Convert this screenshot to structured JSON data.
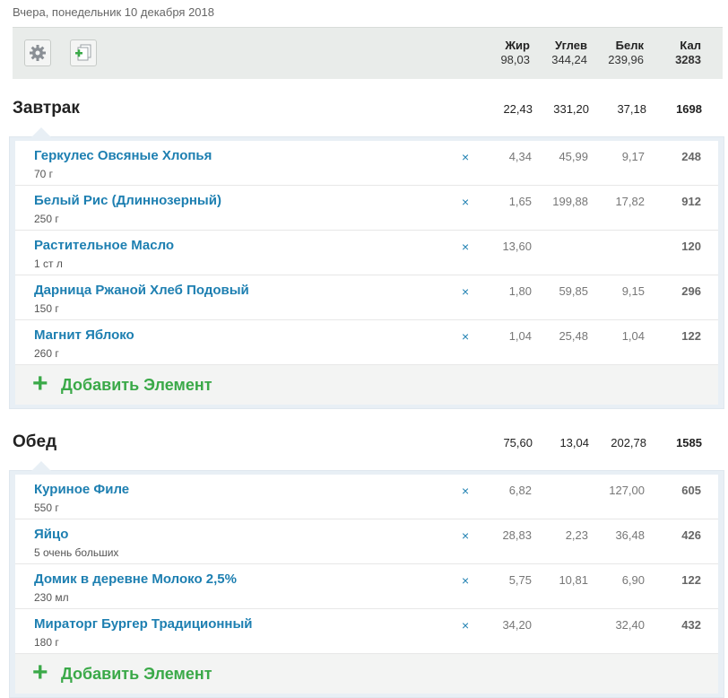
{
  "date_label": "Вчера, понедельник 10 декабря 2018",
  "toolbar": {
    "settings_icon": "gear-icon",
    "copy_icon": "copy-add-icon"
  },
  "totals": {
    "fat_label": "Жир",
    "fat": "98,03",
    "carbs_label": "Углев",
    "carbs": "344,24",
    "protein_label": "Белк",
    "protein": "239,96",
    "cal_label": "Кал",
    "cal": "3283"
  },
  "meals": [
    {
      "title": "Завтрак",
      "fat": "22,43",
      "carbs": "331,20",
      "protein": "37,18",
      "cal": "1698",
      "items": [
        {
          "name": "Геркулес Овсяные Хлопья",
          "qty": "70 г",
          "fat": "4,34",
          "carbs": "45,99",
          "protein": "9,17",
          "cal": "248"
        },
        {
          "name": "Белый Рис (Длиннозерный)",
          "qty": "250 г",
          "fat": "1,65",
          "carbs": "199,88",
          "protein": "17,82",
          "cal": "912"
        },
        {
          "name": "Растительное Масло",
          "qty": "1 ст л",
          "fat": "13,60",
          "carbs": "",
          "protein": "",
          "cal": "120"
        },
        {
          "name": "Дарница Ржаной Хлеб Подовый",
          "qty": "150 г",
          "fat": "1,80",
          "carbs": "59,85",
          "protein": "9,15",
          "cal": "296"
        },
        {
          "name": "Магнит Яблоко",
          "qty": "260 г",
          "fat": "1,04",
          "carbs": "25,48",
          "protein": "1,04",
          "cal": "122"
        }
      ],
      "add_label": "Добавить Элемент"
    },
    {
      "title": "Обед",
      "fat": "75,60",
      "carbs": "13,04",
      "protein": "202,78",
      "cal": "1585",
      "items": [
        {
          "name": "Куриное Филе",
          "qty": "550 г",
          "fat": "6,82",
          "carbs": "",
          "protein": "127,00",
          "cal": "605"
        },
        {
          "name": "Яйцо",
          "qty": "5 очень больших",
          "fat": "28,83",
          "carbs": "2,23",
          "protein": "36,48",
          "cal": "426"
        },
        {
          "name": "Домик в деревне Молоко 2,5%",
          "qty": "230 мл",
          "fat": "5,75",
          "carbs": "10,81",
          "protein": "6,90",
          "cal": "122"
        },
        {
          "name": "Мираторг Бургер Традиционный",
          "qty": "180 г",
          "fat": "34,20",
          "carbs": "",
          "protein": "32,40",
          "cal": "432"
        }
      ],
      "add_label": "Добавить Элемент"
    }
  ],
  "delete_symbol": "×",
  "add_symbol": "+"
}
